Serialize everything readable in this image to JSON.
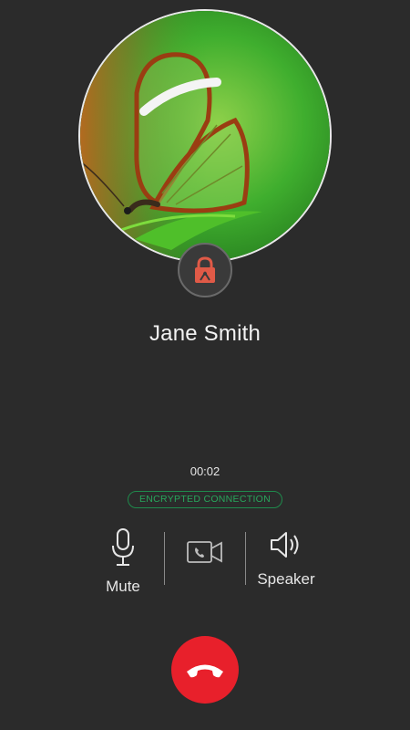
{
  "caller": {
    "name": "Jane Smith"
  },
  "call": {
    "timer": "00:02",
    "encryption_label": "ENCRYPTED CONNECTION"
  },
  "controls": {
    "mute_label": "Mute",
    "speaker_label": "Speaker"
  },
  "icons": {
    "avatar": "butterfly-photo",
    "badge": "lock-icon",
    "mute": "microphone-icon",
    "video": "video-camera-icon",
    "speaker": "speaker-icon",
    "hangup": "phone-hangup-icon"
  },
  "colors": {
    "background": "#2b2b2b",
    "accent_green": "#28a65c",
    "hangup_red": "#e8202b",
    "lock_red": "#e05a47"
  }
}
